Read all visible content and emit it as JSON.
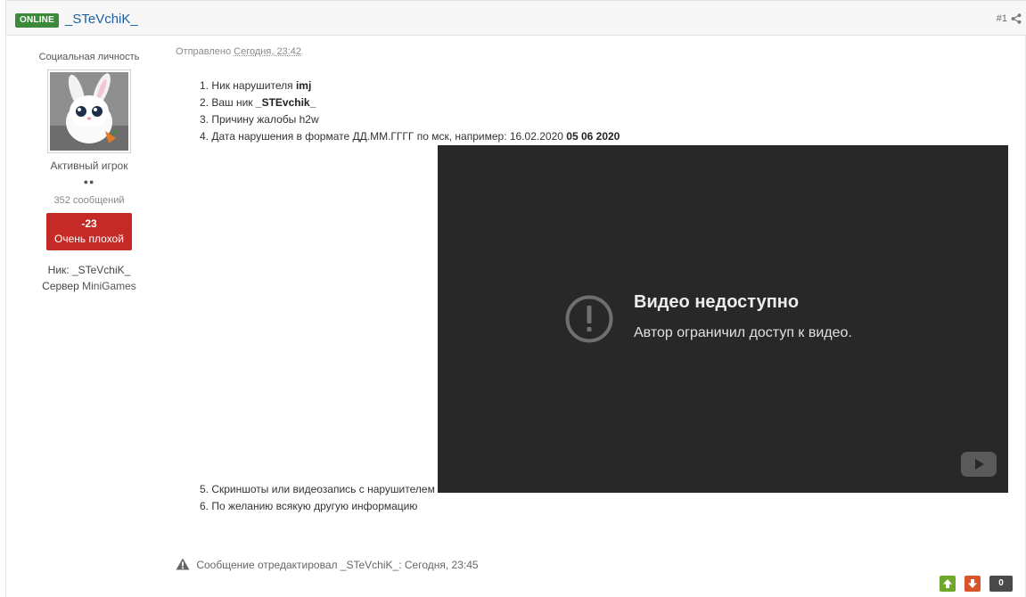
{
  "header": {
    "online_badge": "ONLINE",
    "author": "_STeVchiK_",
    "post_number": "#1",
    "share_icon": "share-icon"
  },
  "sidebar": {
    "user_title": "Социальная личность",
    "rank": "Активный игрок",
    "pips": "●●",
    "post_count": "352 сообщений",
    "reputation_value": "-23",
    "reputation_label": "Очень плохой",
    "nick_label": "Ник:",
    "nick_value": "_STeVchiK_",
    "server_label": "Сервер",
    "server_value": "MiniGames"
  },
  "meta": {
    "sent_label": "Отправлено",
    "time": "Сегодня, 23:42"
  },
  "content": {
    "line1_prefix": "1. Ник нарушителя",
    "line1_bold": "imj",
    "line2_prefix": "2. Ваш ник",
    "line2_bold": "_STEvchik_",
    "line3": "3. Причину жалобы h2w",
    "line4_prefix": "4. Дата нарушения в формате ДД.ММ.ГГГГ по мск, например: 16.02.2020",
    "line4_bold": "05 06 2020",
    "line5": "5. Скриншоты или видеозапись с нарушителем",
    "line6": "6. По желанию всякую другую информацию"
  },
  "video": {
    "title": "Видео недоступно",
    "subtitle": "Автор ограничил доступ к видео.",
    "colors": {
      "background": "#282828",
      "icon": "#6f6f6f"
    }
  },
  "footer": {
    "edit_note": "Сообщение отредактировал _STeVchiK_: Сегодня, 23:45",
    "vote_count": "0"
  },
  "colors": {
    "online": "#3a8a3a",
    "author_link": "#1a5f9e",
    "reputation_bad": "#c52a26",
    "vote_up": "#6ea82b",
    "vote_down": "#d8552a"
  }
}
